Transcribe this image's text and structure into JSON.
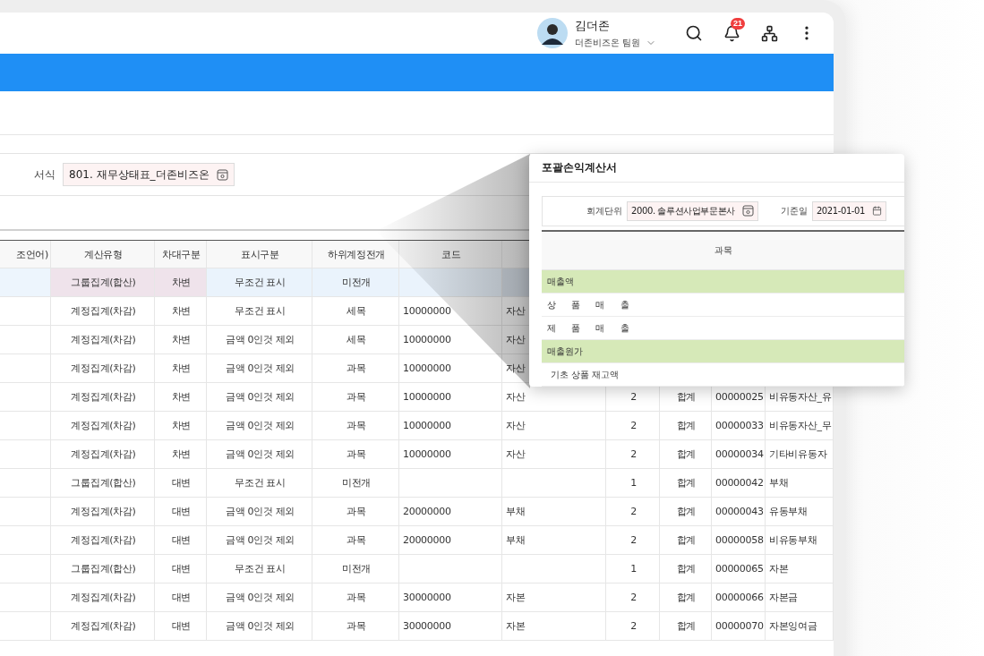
{
  "header": {
    "user": {
      "name": "김더존",
      "role": "더존비즈온 팀원"
    },
    "notifications": "21"
  },
  "filter": {
    "label": "서식",
    "value": "801. 재무상태표_더존비즈온"
  },
  "table": {
    "columns": [
      "조언어)",
      "계산유형",
      "차대구분",
      "표시구분",
      "하위계정전개",
      "코드",
      null,
      null,
      null,
      null,
      null
    ],
    "rows": [
      {
        "selected": true,
        "cells": [
          null,
          "그룹집계(합산)",
          "차변",
          "무조건 표시",
          "미전개",
          null,
          null,
          null,
          null,
          null,
          null
        ]
      },
      {
        "selected": false,
        "cells": [
          null,
          "계정집계(차감)",
          "차변",
          "무조건 표시",
          "세목",
          "10000000",
          "자산",
          null,
          null,
          null,
          null
        ]
      },
      {
        "selected": false,
        "cells": [
          null,
          "계정집계(차감)",
          "차변",
          "금액 0인것 제외",
          "세목",
          "10000000",
          "자산",
          null,
          null,
          null,
          null
        ]
      },
      {
        "selected": false,
        "cells": [
          null,
          "계정집계(차감)",
          "차변",
          "금액 0인것 제외",
          "과목",
          "10000000",
          "자산",
          null,
          null,
          null,
          null
        ]
      },
      {
        "selected": false,
        "cells": [
          null,
          "계정집계(차감)",
          "차변",
          "금액 0인것 제외",
          "과목",
          "10000000",
          "자산",
          "2",
          "합계",
          "00000025",
          "비유동자산_유"
        ]
      },
      {
        "selected": false,
        "cells": [
          null,
          "계정집계(차감)",
          "차변",
          "금액 0인것 제외",
          "과목",
          "10000000",
          "자산",
          "2",
          "합계",
          "00000033",
          "비유동자산_무"
        ]
      },
      {
        "selected": false,
        "cells": [
          null,
          "계정집계(차감)",
          "차변",
          "금액 0인것 제외",
          "과목",
          "10000000",
          "자산",
          "2",
          "합계",
          "00000034",
          "기타비유동자"
        ]
      },
      {
        "selected": false,
        "cells": [
          null,
          "그룹집계(합산)",
          "대변",
          "무조건 표시",
          "미전개",
          null,
          null,
          "1",
          "합계",
          "00000042",
          "부채"
        ]
      },
      {
        "selected": false,
        "cells": [
          null,
          "계정집계(차감)",
          "대변",
          "금액 0인것 제외",
          "과목",
          "20000000",
          "부채",
          "2",
          "합계",
          "00000043",
          "유동부채"
        ]
      },
      {
        "selected": false,
        "cells": [
          null,
          "계정집계(차감)",
          "대변",
          "금액 0인것 제외",
          "과목",
          "20000000",
          "부채",
          "2",
          "합계",
          "00000058",
          "비유동부채"
        ]
      },
      {
        "selected": false,
        "cells": [
          null,
          "그룹집계(합산)",
          "대변",
          "무조건 표시",
          "미전개",
          null,
          null,
          "1",
          "합계",
          "00000065",
          "자본"
        ]
      },
      {
        "selected": false,
        "cells": [
          null,
          "계정집계(차감)",
          "대변",
          "금액 0인것 제외",
          "과목",
          "30000000",
          "자본",
          "2",
          "합계",
          "00000066",
          "자본금"
        ]
      },
      {
        "selected": false,
        "cells": [
          null,
          "계정집계(차감)",
          "대변",
          "금액 0인것 제외",
          "과목",
          "30000000",
          "자본",
          "2",
          "합계",
          "00000070",
          "자본잉여금"
        ]
      }
    ]
  },
  "popup": {
    "title": "포괄손익계산서",
    "fields": [
      {
        "kind": "lookup",
        "label": "회계단위",
        "value": "2000. 솔루션사업부문본사"
      },
      {
        "kind": "date",
        "label": "기준일",
        "value": "2021-01-01"
      }
    ],
    "column": "과목",
    "rows": [
      {
        "kind": "group",
        "text": "매출액"
      },
      {
        "kind": "item",
        "text": "상 품 매 출"
      },
      {
        "kind": "item",
        "text": "제 품 매 출"
      },
      {
        "kind": "group",
        "text": "매출원가"
      },
      {
        "kind": "subitem",
        "text": "기초 상품 재고액"
      }
    ]
  }
}
